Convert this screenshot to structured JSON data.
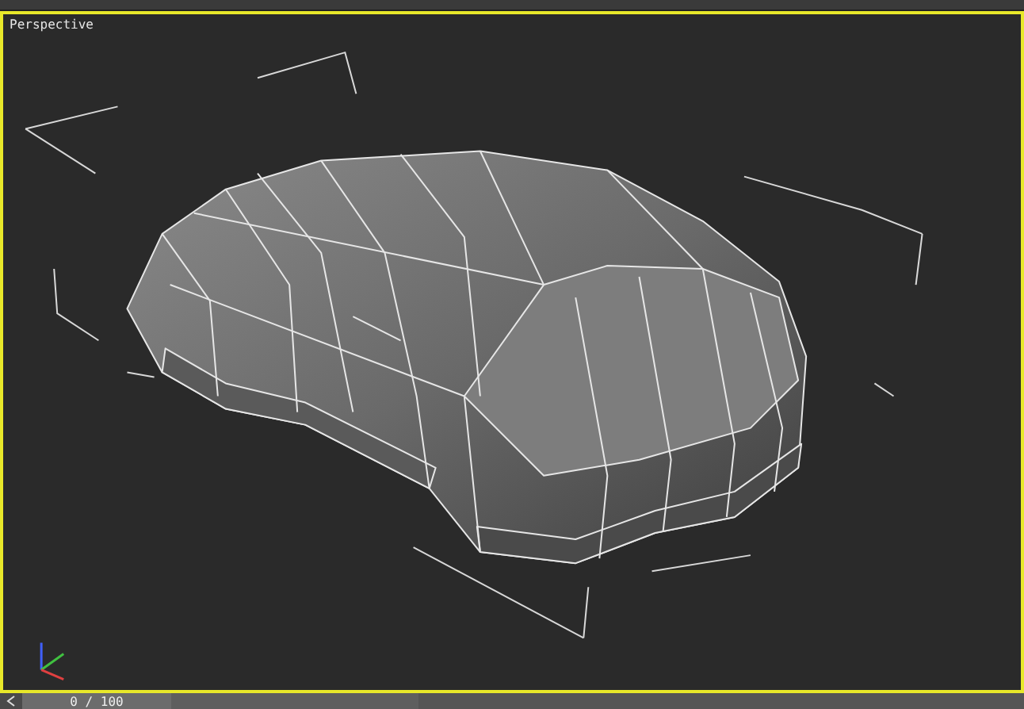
{
  "viewport": {
    "label": "Perspective",
    "active": true
  },
  "time_slider": {
    "frame": "0 / 100",
    "level": 0
  }
}
